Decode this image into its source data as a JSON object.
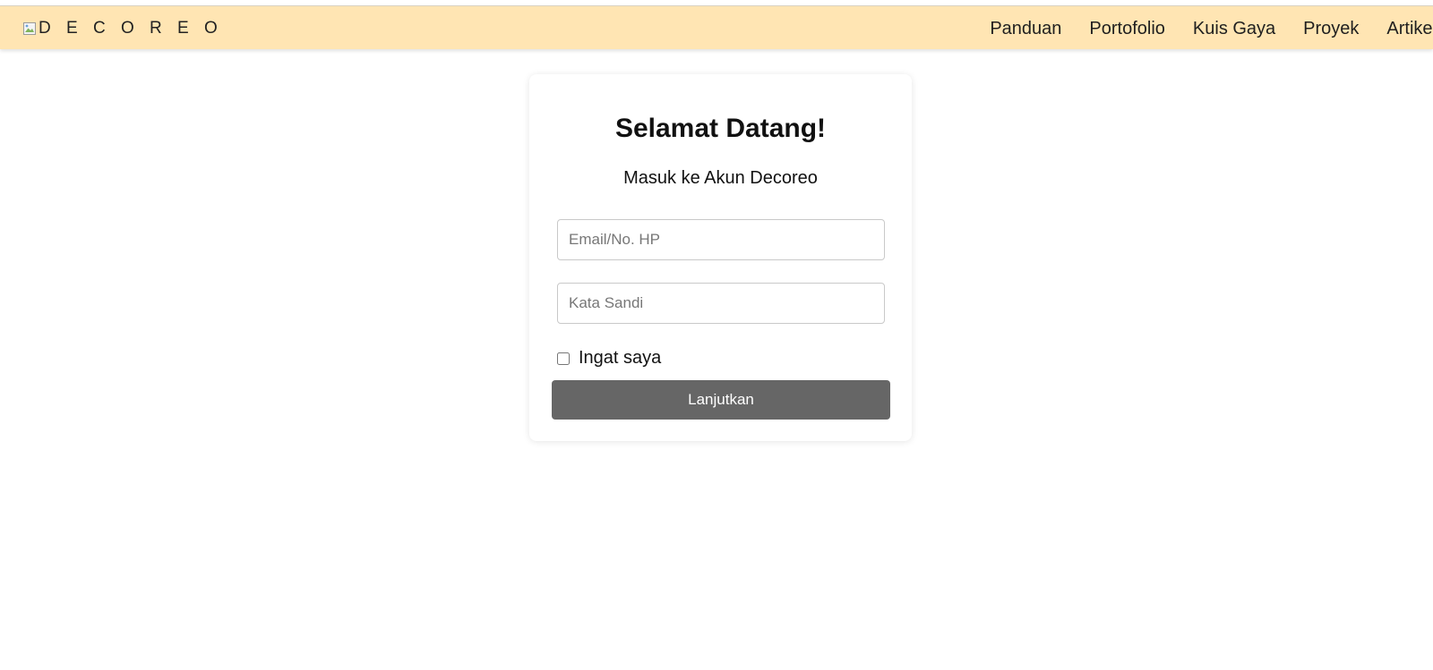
{
  "navbar": {
    "brand_text": "D E C O R E O",
    "brand_icon": "broken-image-icon",
    "links": [
      {
        "label": "Panduan"
      },
      {
        "label": "Portofolio"
      },
      {
        "label": "Kuis Gaya"
      },
      {
        "label": "Proyek"
      },
      {
        "label": "Artikel"
      }
    ],
    "background_color": "#ffe5b3"
  },
  "login": {
    "title": "Selamat Datang!",
    "subtitle": "Masuk ke Akun Decoreo",
    "email_placeholder": "Email/No. HP",
    "email_value": "",
    "password_placeholder": "Kata Sandi",
    "password_value": "",
    "remember_label": "Ingat saya",
    "remember_checked": false,
    "submit_label": "Lanjutkan",
    "submit_color": "#666666"
  }
}
